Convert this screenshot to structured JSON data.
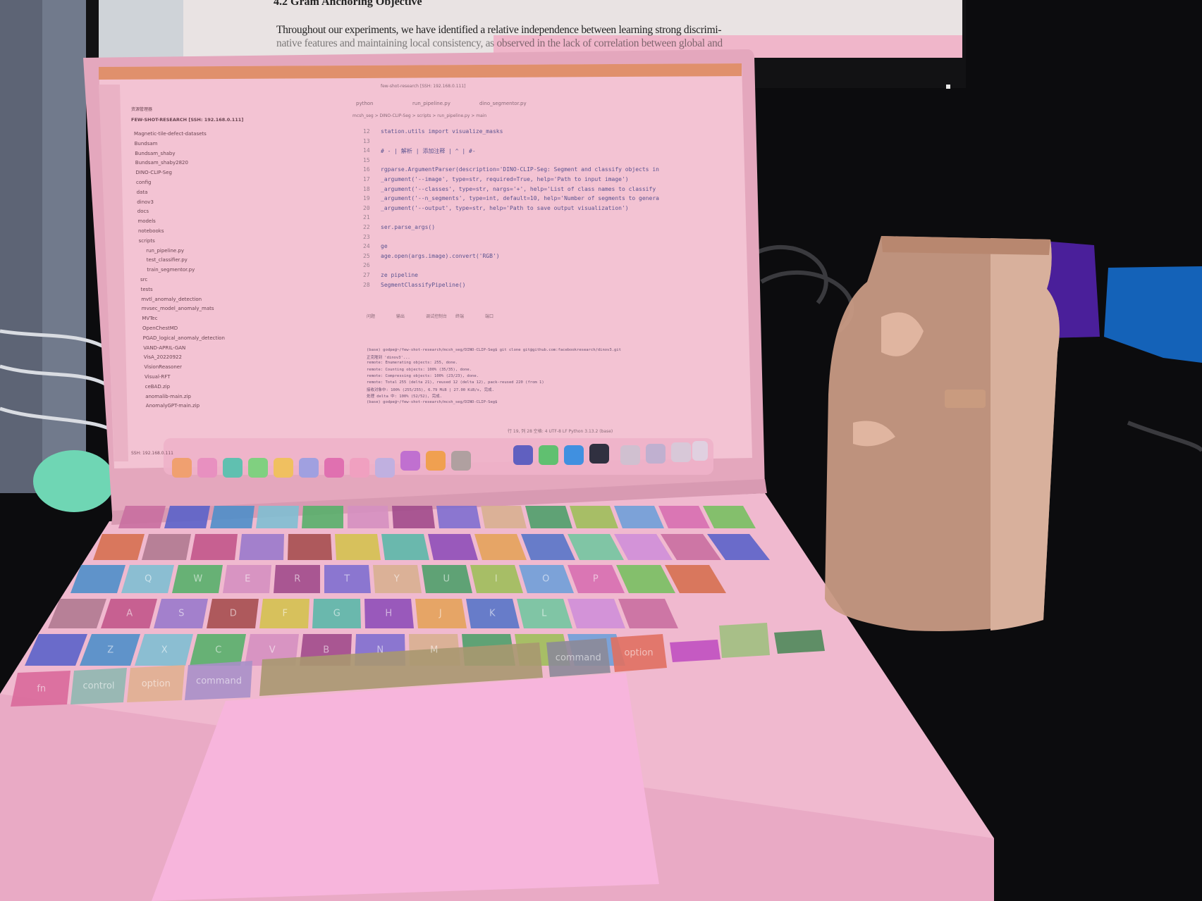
{
  "monitor": {
    "heading": "4.2   Gram Anchoring Objective",
    "line1": "Throughout our experiments, we have identified a relative independence between learning strong discrimi-",
    "line2": "native features and maintaining local consistency, as observed in the lack of correlation between global and"
  },
  "editor": {
    "title": "few-shot-research [SSH: 192.168.0.111]",
    "explorer_label": "资源管理器",
    "root_label": "FEW-SHOT-RESEARCH [SSH: 192.168.0.111]",
    "tabs": [
      "python",
      "run_pipeline.py",
      "dino_segmentor.py"
    ],
    "breadcrumb": "mcsh_seg > DINO-CLIP-Seg > scripts > run_pipeline.py > main",
    "sidebar_items": [
      "Magnetic-tile-defect-datasets",
      "Bundsam",
      "Bundsam_shaby",
      "Bundsam_shaby2820",
      "DINO-CLIP-Seg",
      "config",
      "data",
      "dinov3",
      "docs",
      "models",
      "notebooks",
      "scripts",
      "run_pipeline.py",
      "test_classifier.py",
      "train_segmentor.py",
      "src",
      "tests",
      "mvtl_anomaly_detection",
      "mvsec_model_anomaly_mats",
      "MVTec",
      "OpenChestMD",
      "PGAD_logical_anomaly_detection",
      "VAND-APRIL-GAN",
      "VisA_20220922",
      "VisionReasoner",
      "Visual-RFT",
      "ceBAD.zip",
      "anomalib-main.zip",
      "AnomalyGPT-main.zip"
    ],
    "code_lines": [
      {
        "n": "12",
        "t": "station.utils import visualize_masks"
      },
      {
        "n": "13",
        "t": ""
      },
      {
        "n": "14",
        "t": "  # - | 解析 | 添加注释 | ^ | #-"
      },
      {
        "n": "15",
        "t": ""
      },
      {
        "n": "16",
        "t": "rgparse.ArgumentParser(description='DINO-CLIP-Seg: Segment and classify objects in"
      },
      {
        "n": "17",
        "t": "_argument('--image', type=str, required=True, help='Path to input image')"
      },
      {
        "n": "18",
        "t": "_argument('--classes', type=str, nargs='+', help='List of class names to classify"
      },
      {
        "n": "19",
        "t": "_argument('--n_segments', type=int, default=10, help='Number of segments to genera"
      },
      {
        "n": "20",
        "t": "_argument('--output', type=str, help='Path to save output visualization')"
      },
      {
        "n": "21",
        "t": ""
      },
      {
        "n": "22",
        "t": "ser.parse_args()"
      },
      {
        "n": "23",
        "t": ""
      },
      {
        "n": "24",
        "t": "ge"
      },
      {
        "n": "25",
        "t": "age.open(args.image).convert('RGB')"
      },
      {
        "n": "26",
        "t": ""
      },
      {
        "n": "27",
        "t": "ze pipeline"
      },
      {
        "n": "28",
        "t": "SegmentClassifyPipeline()"
      }
    ],
    "terminal_tabs": [
      "问题",
      "输出",
      "调试控制台",
      "终端",
      "端口"
    ],
    "terminal_lines": [
      "(base) godpe@~/few-shot-research/mcsh_seg/DINO-CLIP-Seg$ git clone git@github.com:facebookresearch/dinov3.git",
      "正克隆到 'dinov3'...",
      "remote: Enumerating objects: 255, done.",
      "remote: Counting objects: 100% (35/35), done.",
      "remote: Compressing objects: 100% (23/23), done.",
      "remote: Total 255 (delta 21), reused 12 (delta 12), pack-reused 220 (from 1)",
      "接收对象中: 100% (255/255), 6.79 MiB | 27.00 KiB/s, 完成.",
      "处理 delta 中: 100% (52/52), 完成.",
      "(base) godpe@~/few-shot-research/mcsh_seg/DINO-CLIP-Seg$"
    ],
    "status_left": "SSH: 192.168.0.111",
    "status_right": "行 19, 列 28   空格: 4   UTF-8   LF   Python   3.13.2 (base)"
  },
  "keyboard": {
    "letters": [
      "Q",
      "W",
      "E",
      "R",
      "T",
      "Y",
      "U",
      "I",
      "O",
      "P",
      "A",
      "S",
      "D",
      "F",
      "G",
      "H",
      "J",
      "K",
      "L",
      "Z",
      "X",
      "C",
      "V",
      "B",
      "N",
      "M"
    ],
    "left_command": "command",
    "left_option": "option",
    "right_command": "command",
    "right_option": "option",
    "control": "control",
    "fn": "fn"
  },
  "colors": {
    "laptop_overlay": "#f2b8cf",
    "jar_overlay": "#c89a84",
    "blue_object": "#1462b8",
    "purple_object": "#4a1f9a",
    "mint_object": "#6fd6b4",
    "desk": "#0c0c0e"
  }
}
